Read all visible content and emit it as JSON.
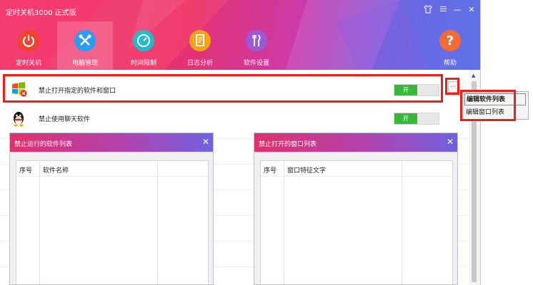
{
  "window": {
    "title": "定时关机3000 正式版",
    "shirt_icon": "shirt-skin-icon",
    "minimize_label": "—",
    "close_label": "✕"
  },
  "nav": [
    {
      "label": "定时关机",
      "icon": "power-icon",
      "color": "#f0442e"
    },
    {
      "label": "电脑管理",
      "icon": "tools-icon",
      "color": "#2d9cf0",
      "active": true
    },
    {
      "label": "时间限制",
      "icon": "timer-icon",
      "color": "#25b9c9"
    },
    {
      "label": "日志分析",
      "icon": "log-document-icon",
      "color": "#f3a21a"
    },
    {
      "label": "软件设置",
      "icon": "fork-knife-icon",
      "color": "#9b59d6"
    },
    {
      "label": "帮助",
      "icon": "question-icon",
      "color": "#f26b33"
    }
  ],
  "rows": [
    {
      "label": "禁止打开指定的软件和窗口",
      "icon": "windows-blocked-icon",
      "toggle": "开"
    },
    {
      "label": "禁止使用聊天软件",
      "icon": "qq-penguin-icon",
      "toggle": "开"
    }
  ],
  "more_button": "...",
  "dialogs": {
    "software": {
      "title": "禁止运行的软件列表",
      "col1": "序号",
      "col2": "软件名称"
    },
    "window": {
      "title": "禁止打开的窗口列表",
      "col1": "序号",
      "col2": "窗口特征文字"
    },
    "close_label": "✕"
  },
  "context_menu": {
    "items": [
      "编辑软件列表",
      "编辑窗口列表"
    ]
  },
  "colors": {
    "accent_red": "#e8221b",
    "toggle_green": "#37b83b"
  }
}
